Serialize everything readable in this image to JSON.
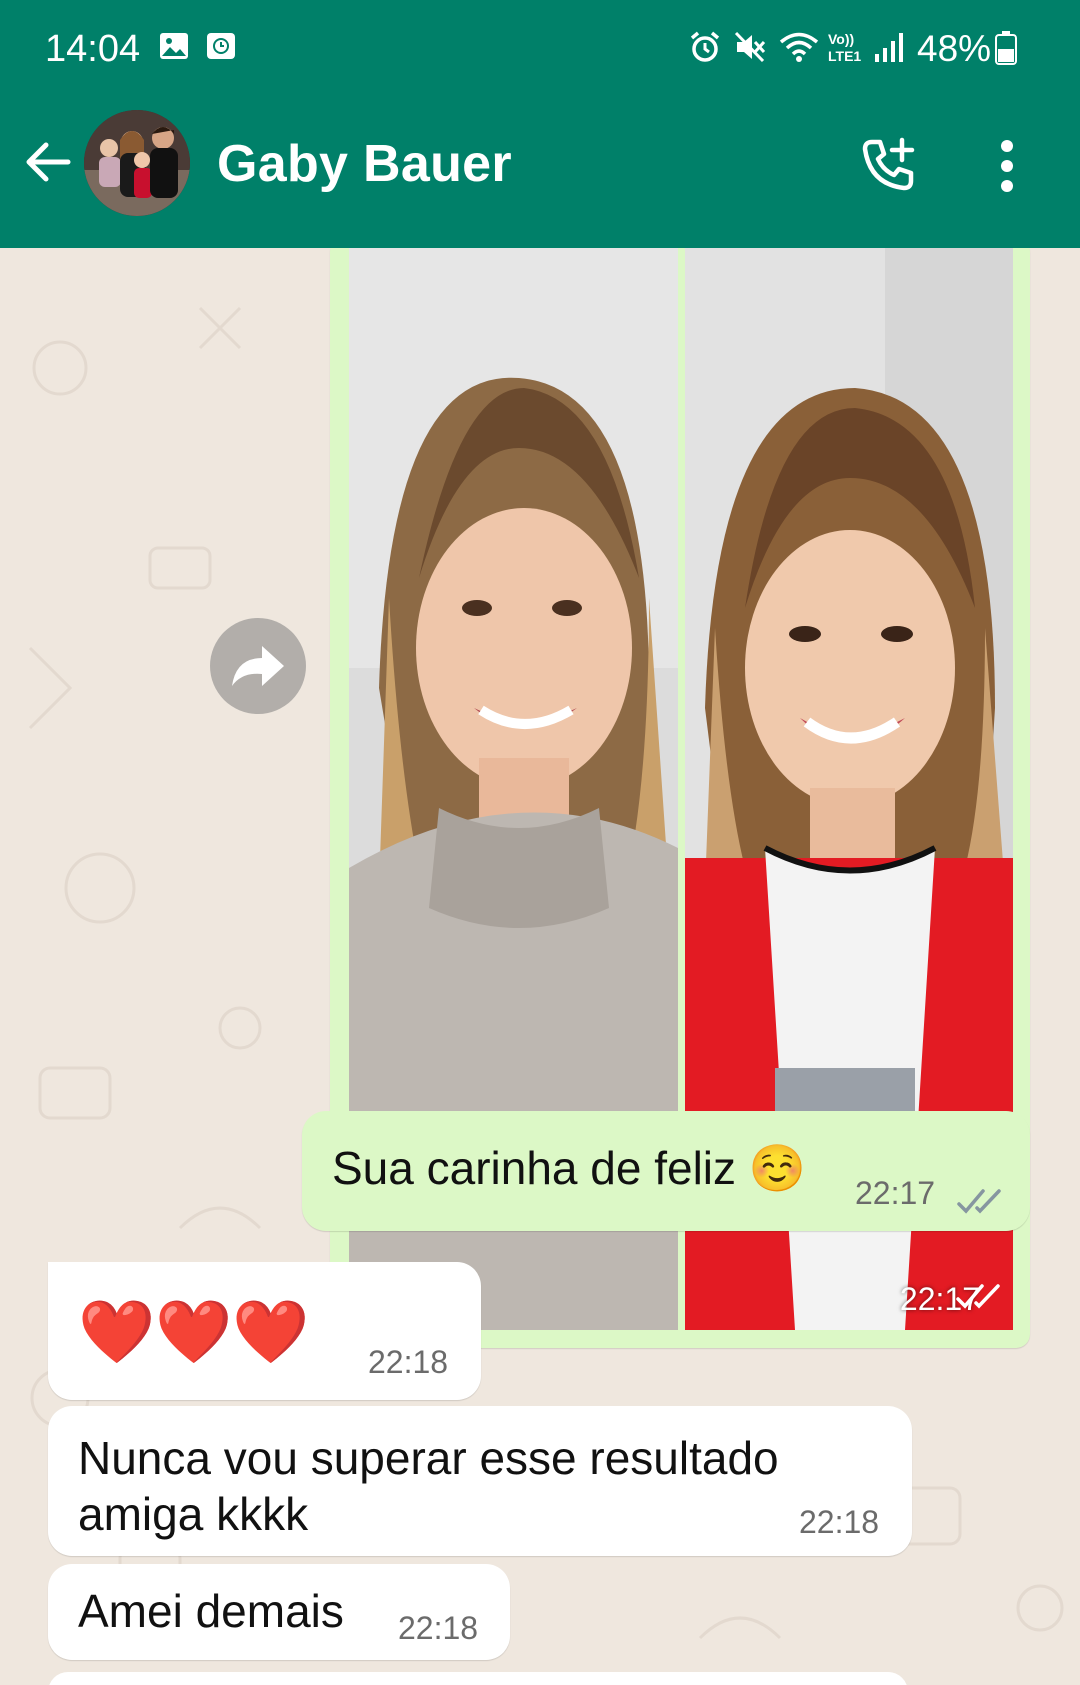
{
  "status_bar": {
    "time": "14:04",
    "battery": "48%",
    "icons": [
      "gallery-icon",
      "screen-recorder-icon",
      "alarm-icon",
      "mute-icon",
      "wifi-icon",
      "volte-icon",
      "signal-icon",
      "battery-icon"
    ]
  },
  "header": {
    "contact_name": "Gaby Bauer",
    "back_icon": "back-arrow-icon",
    "call_icon": "add-call-icon",
    "menu_icon": "more-vertical-icon"
  },
  "colors": {
    "header": "#008069",
    "outgoing_bubble": "#dcf8c6",
    "incoming_bubble": "#ffffff",
    "chat_background": "#efe7de",
    "read_ticks": "#8696a0"
  },
  "messages": [
    {
      "type": "image",
      "direction": "outgoing",
      "time": "22:17",
      "status": "read"
    },
    {
      "type": "text",
      "direction": "outgoing",
      "text": "Sua carinha de feliz ☺️",
      "time": "22:17",
      "status": "read"
    },
    {
      "type": "text",
      "direction": "incoming",
      "text": "❤️❤️❤️",
      "time": "22:18"
    },
    {
      "type": "text",
      "direction": "incoming",
      "text": "Nunca vou superar esse resultado amiga kkkk",
      "time": "22:18"
    },
    {
      "type": "text",
      "direction": "incoming",
      "text": "Amei demais",
      "time": "22:18"
    }
  ]
}
